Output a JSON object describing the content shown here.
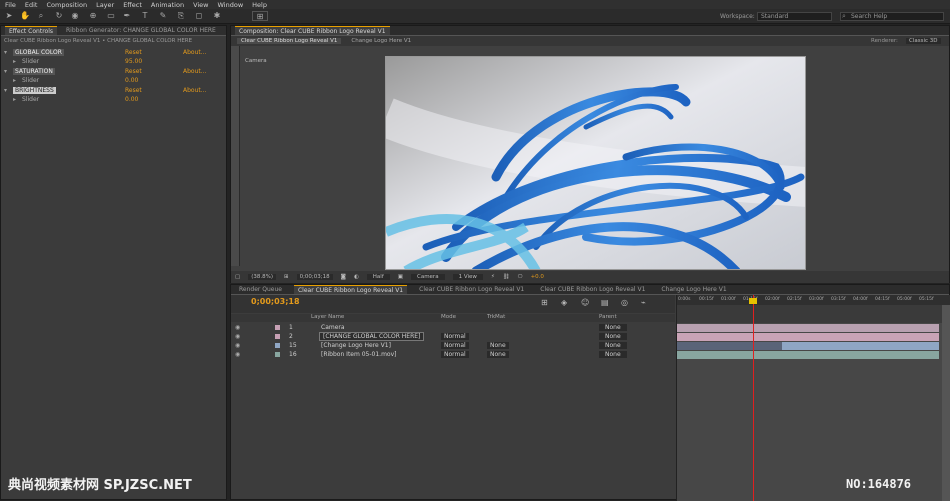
{
  "menu": [
    "File",
    "Edit",
    "Composition",
    "Layer",
    "Effect",
    "Animation",
    "View",
    "Window",
    "Help"
  ],
  "toolbar": {
    "workspace_label": "Workspace:",
    "workspace_value": "Standard",
    "search_placeholder": "Search Help"
  },
  "effect_controls": {
    "tab_label": "Effect Controls",
    "header": "Ribbon Generator: CHANGE GLOBAL COLOR HERE",
    "path": "Clear CUBE Ribbon Logo Reveal V1 • CHANGE GLOBAL COLOR HERE",
    "effects": [
      {
        "name": "GLOBAL COLOR",
        "reset": "Reset",
        "about": "About..."
      },
      {
        "name": "Slider",
        "value": "95.00"
      },
      {
        "name": "SATURATION",
        "reset": "Reset",
        "about": "About..."
      },
      {
        "name": "Slider",
        "value": "0.00"
      },
      {
        "name": "BRIGHTNESS",
        "reset": "Reset",
        "about": "About..."
      },
      {
        "name": "Slider",
        "value": "0.00"
      }
    ]
  },
  "composition": {
    "panel_title": "Composition: Clear CUBE Ribbon Logo Reveal V1",
    "tabs": [
      "Clear CUBE Ribbon Logo Reveal V1",
      "Change Logo Here V1"
    ],
    "renderer": "Renderer:",
    "renderer_value": "Classic 3D",
    "camera_label": "Camera",
    "zoom": "(38.8%)",
    "timecode": "0;00;03;18",
    "resolution": "Half",
    "view": "Camera",
    "views": "1 View",
    "exposure": "+0.0"
  },
  "timeline": {
    "tabs": [
      "Render Queue",
      "Clear CUBE Ribbon Logo Reveal V1",
      "Clear CUBE Ribbon Logo Reveal V1",
      "Clear CUBE Ribbon Logo Reveal V1",
      "Change Logo Here V1"
    ],
    "current_time": "0;00;03;18",
    "columns": {
      "name": "Layer Name",
      "mode": "Mode",
      "trkmat": "TrkMat",
      "parent": "Parent"
    },
    "layers": [
      {
        "num": "1",
        "name": "Camera",
        "mode": "",
        "trkmat": "",
        "parent": "None"
      },
      {
        "num": "2",
        "name": "[CHANGE GLOBAL COLOR HERE]",
        "mode": "Normal",
        "trkmat": "",
        "parent": "None"
      },
      {
        "num": "15",
        "name": "[Change Logo Here V1]",
        "mode": "Normal",
        "trkmat": "None",
        "parent": "None"
      },
      {
        "num": "16",
        "name": "[Ribbon Item 05-01.mov]",
        "mode": "Normal",
        "trkmat": "None",
        "parent": "None"
      }
    ],
    "ruler": [
      "0:00s",
      "00:15f",
      "01:00f",
      "01:15f",
      "02:00f",
      "02:15f",
      "03:00f",
      "03:15f",
      "04:00f",
      "04:15f",
      "05:00f",
      "05:15f"
    ]
  },
  "watermark": {
    "left": "典尚视频素材网 SP.JZSC.NET",
    "right": "NO:164876"
  },
  "colors": {
    "accent": "#e39a1c",
    "camera_bar": "#b8a0b0",
    "layer_bar_pink": "#c9a3b6",
    "layer_bar_blue": "#8fa6c4",
    "layer_bar_teal": "#88a6a0",
    "playhead": "#e02020"
  }
}
